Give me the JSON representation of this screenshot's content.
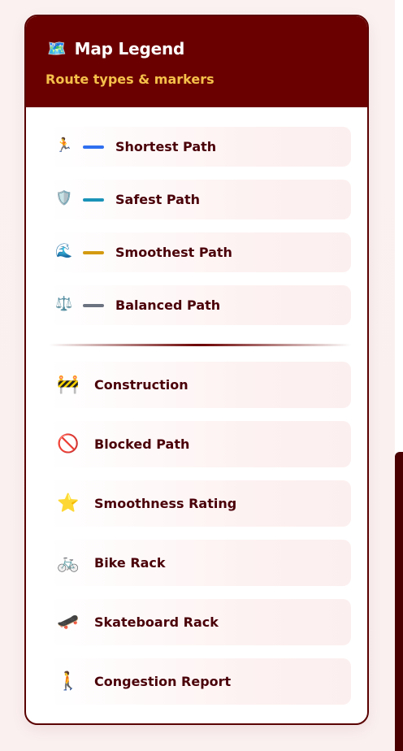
{
  "legend": {
    "title_icon": "🗺️",
    "title": "Map Legend",
    "subtitle": "Route types & markers",
    "routes": [
      {
        "icon": "🏃",
        "icon_name": "runner-icon",
        "color": "#2f6ff0",
        "label": "Shortest Path"
      },
      {
        "icon": "🛡️",
        "icon_name": "shield-icon",
        "color": "#1a93b8",
        "label": "Safest Path"
      },
      {
        "icon": "🌊",
        "icon_name": "wave-icon",
        "color": "#d49a10",
        "label": "Smoothest Path"
      },
      {
        "icon": "⚖️",
        "icon_name": "scales-icon",
        "color": "#6b7280",
        "label": "Balanced Path"
      }
    ],
    "markers": [
      {
        "icon": "🚧",
        "icon_name": "construction-icon",
        "label": "Construction"
      },
      {
        "icon": "🚫",
        "icon_name": "blocked-icon",
        "label": "Blocked Path"
      },
      {
        "icon": "⭐",
        "icon_name": "star-icon",
        "label": "Smoothness Rating"
      },
      {
        "icon": "🚲",
        "icon_name": "bike-icon",
        "label": "Bike Rack"
      },
      {
        "icon": "🛹",
        "icon_name": "skateboard-icon",
        "label": "Skateboard Rack"
      },
      {
        "icon": "🚶",
        "icon_name": "pedestrian-icon",
        "label": "Congestion Report"
      }
    ],
    "colors": {
      "header_bg": "#6b0000",
      "subtitle": "#f5c04a",
      "text": "#4a0008",
      "border": "#5a0000"
    }
  }
}
